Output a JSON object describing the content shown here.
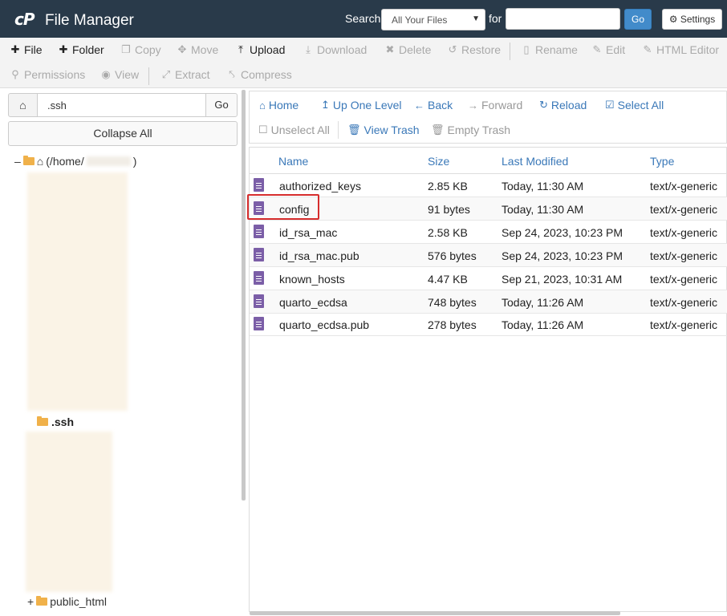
{
  "header": {
    "logo": "cP",
    "title": "File Manager",
    "search_label": "Search",
    "scope_value": "All Your Files",
    "for_label": "for",
    "search_placeholder": "",
    "go_label": "Go",
    "settings_label": "Settings"
  },
  "toolbar": {
    "row1": [
      "File",
      "Folder",
      "Copy",
      "Move",
      "Upload",
      "Download",
      "Delete",
      "Restore",
      "Rename",
      "Edit",
      "HTML Editor"
    ],
    "row2": [
      "Permissions",
      "View",
      "Extract",
      "Compress"
    ]
  },
  "sidebar": {
    "path_value": ".ssh",
    "go_label": "Go",
    "collapse_label": "Collapse All",
    "root_label": "(/home/",
    "root_suffix": ")",
    "current_folder": ".ssh",
    "public_folder": "public_html"
  },
  "nav": {
    "items": [
      "Home",
      "Up One Level",
      "Back",
      "Forward",
      "Reload",
      "Select All",
      "Unselect All",
      "View Trash",
      "Empty Trash"
    ]
  },
  "table": {
    "headers": [
      "Name",
      "Size",
      "Last Modified",
      "Type"
    ],
    "rows": [
      {
        "name": "authorized_keys",
        "size": "2.85 KB",
        "modified": "Today, 11:30 AM",
        "type": "text/x-generic"
      },
      {
        "name": "config",
        "size": "91 bytes",
        "modified": "Today, 11:30 AM",
        "type": "text/x-generic"
      },
      {
        "name": "id_rsa_mac",
        "size": "2.58 KB",
        "modified": "Sep 24, 2023, 10:23 PM",
        "type": "text/x-generic"
      },
      {
        "name": "id_rsa_mac.pub",
        "size": "576 bytes",
        "modified": "Sep 24, 2023, 10:23 PM",
        "type": "text/x-generic"
      },
      {
        "name": "known_hosts",
        "size": "4.47 KB",
        "modified": "Sep 21, 2023, 10:31 AM",
        "type": "text/x-generic"
      },
      {
        "name": "quarto_ecdsa",
        "size": "748 bytes",
        "modified": "Today, 11:26 AM",
        "type": "text/x-generic"
      },
      {
        "name": "quarto_ecdsa.pub",
        "size": "278 bytes",
        "modified": "Today, 11:26 AM",
        "type": "text/x-generic"
      }
    ]
  },
  "colors": {
    "header_bg": "#293a4a",
    "link": "#3a78b8",
    "file_icon": "#7b5ea7",
    "highlight": "#d62d2d",
    "primary_button": "#428bca"
  }
}
